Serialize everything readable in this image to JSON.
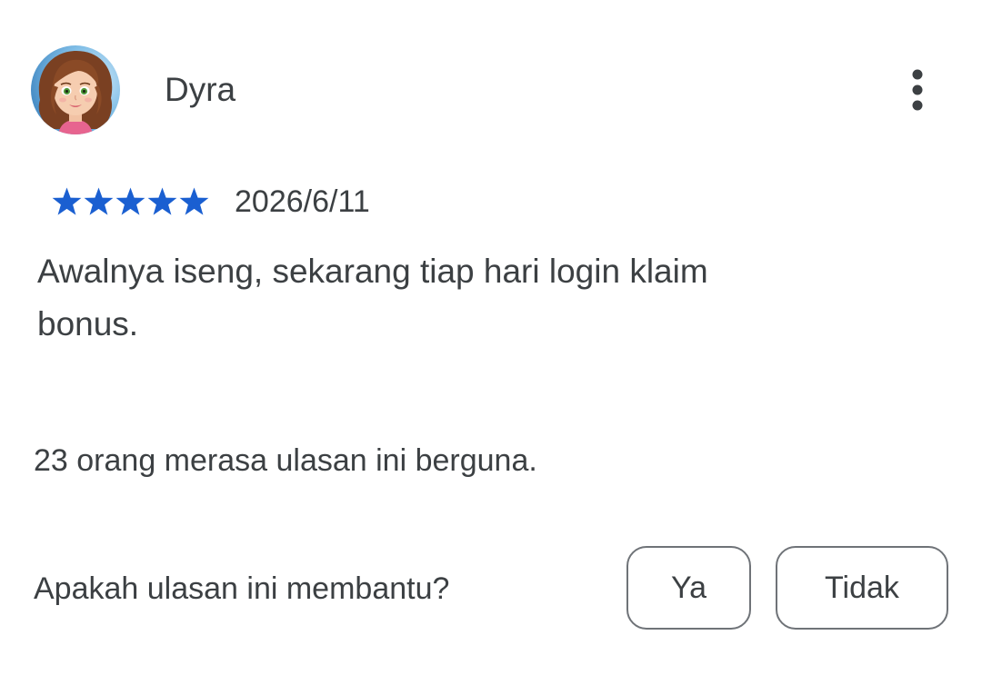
{
  "review": {
    "reviewer_name": "Dyra",
    "rating": 5,
    "rating_max": 5,
    "date": "2026/6/11",
    "text": "Awalnya iseng, sekarang tiap hari login klaim bonus.",
    "helpful_count_text": "23 orang merasa ulasan ini berguna."
  },
  "feedback": {
    "question": "Apakah ulasan ini membantu?",
    "yes_label": "Ya",
    "no_label": "Tidak"
  },
  "icons": {
    "more": "more-vert-icon",
    "star": "star-icon",
    "avatar": "avatar-portrait"
  },
  "colors": {
    "star": "#1a5fd1",
    "text": "#3c4043",
    "button_border": "#6f7378",
    "background": "#ffffff"
  }
}
